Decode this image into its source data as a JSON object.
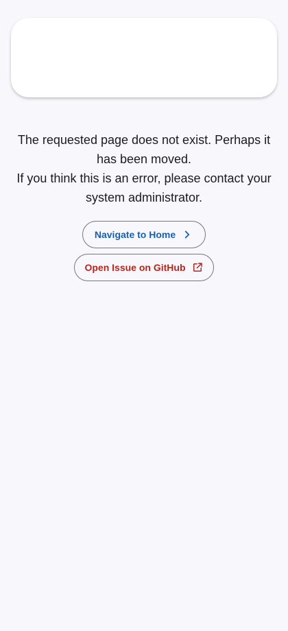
{
  "error": {
    "line1": "The requested page does not exist. Perhaps it has been moved.",
    "line2": "If you think this is an error, please contact your system administrator."
  },
  "actions": {
    "home_label": "Navigate to Home",
    "home_icon": "chevron-right-icon",
    "issue_label": "Open Issue on GitHub",
    "issue_icon": "open-external-icon"
  },
  "colors": {
    "background": "#f8f7fc",
    "primary": "#1a5fae",
    "error": "#b3261e",
    "outline": "#74777f"
  }
}
